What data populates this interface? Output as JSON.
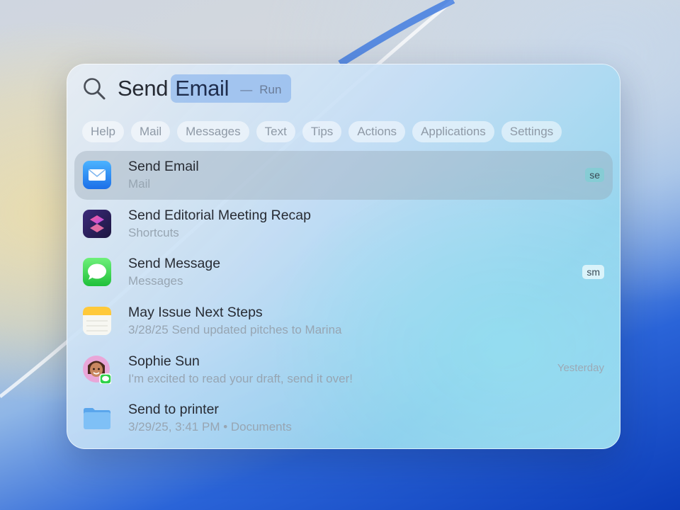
{
  "search": {
    "query": "Send",
    "completion": "Email",
    "separator": "—",
    "action": "Run"
  },
  "filters": [
    "Help",
    "Mail",
    "Messages",
    "Text",
    "Tips",
    "Actions",
    "Applications",
    "Settings"
  ],
  "results": [
    {
      "title": "Send Email",
      "subtitle": "Mail",
      "badge": "se",
      "icon": "mail-icon",
      "selected": true
    },
    {
      "title": "Send Editorial Meeting Recap",
      "subtitle": "Shortcuts",
      "icon": "shortcuts-icon"
    },
    {
      "title": "Send Message",
      "subtitle": "Messages",
      "badge": "sm",
      "icon": "messages-icon"
    },
    {
      "title": "May Issue Next Steps",
      "subtitle": "3/28/25 Send updated pitches to Marina",
      "icon": "notes-icon"
    },
    {
      "title": "Sophie Sun",
      "subtitle": "I'm excited to read your draft, send it over!",
      "date": "Yesterday",
      "icon": "contact-avatar-icon"
    },
    {
      "title": "Send to printer",
      "subtitle": "3/29/25, 3:41 PM • Documents",
      "icon": "folder-icon"
    }
  ]
}
